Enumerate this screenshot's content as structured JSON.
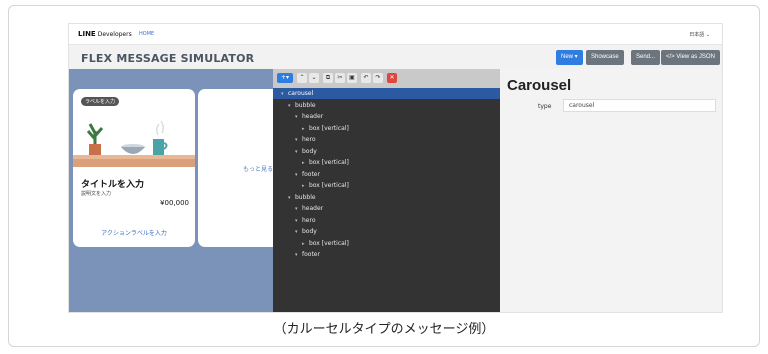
{
  "nav": {
    "brand": "LINE",
    "brand_sub": "Developers",
    "home": "HOME",
    "lang": "日本語 ⌄"
  },
  "header": {
    "title": "FLEX MESSAGE SIMULATOR",
    "new_btn": "New ▾",
    "showcase_btn": "Showcase",
    "send_btn": "Send...",
    "json_btn": "</> View as JSON"
  },
  "preview": {
    "card1": {
      "badge": "ラベルを入力",
      "title": "タイトルを入力",
      "desc": "説明文を入力",
      "price": "¥00,000",
      "action": "アクションラベルを入力"
    },
    "card2": {
      "more": "もっと見る"
    }
  },
  "toolbar": {
    "add": "+▾",
    "up": "⌃",
    "down": "⌄",
    "copy": "⧉",
    "cut": "✂",
    "paste": "▣",
    "undo": "↶",
    "redo": "↷",
    "delete": "✕"
  },
  "tree": [
    {
      "label": "carousel",
      "arrow": "▾",
      "indent": 0,
      "selected": true
    },
    {
      "label": "bubble",
      "arrow": "▾",
      "indent": 1
    },
    {
      "label": "header",
      "arrow": "▾",
      "indent": 2
    },
    {
      "label": "box [vertical]",
      "arrow": "▸",
      "indent": 3
    },
    {
      "label": "hero",
      "arrow": "▾",
      "indent": 2
    },
    {
      "label": "body",
      "arrow": "▾",
      "indent": 2
    },
    {
      "label": "box [vertical]",
      "arrow": "▸",
      "indent": 3
    },
    {
      "label": "footer",
      "arrow": "▾",
      "indent": 2
    },
    {
      "label": "box [vertical]",
      "arrow": "▸",
      "indent": 3
    },
    {
      "label": "bubble",
      "arrow": "▾",
      "indent": 1
    },
    {
      "label": "header",
      "arrow": "▾",
      "indent": 2
    },
    {
      "label": "hero",
      "arrow": "▾",
      "indent": 2
    },
    {
      "label": "body",
      "arrow": "▾",
      "indent": 2
    },
    {
      "label": "box [vertical]",
      "arrow": "▸",
      "indent": 3
    },
    {
      "label": "footer",
      "arrow": "▾",
      "indent": 2
    }
  ],
  "props": {
    "title": "Carousel",
    "type_label": "type",
    "type_value": "carousel"
  },
  "caption": "（カルーセルタイプのメッセージ例）"
}
